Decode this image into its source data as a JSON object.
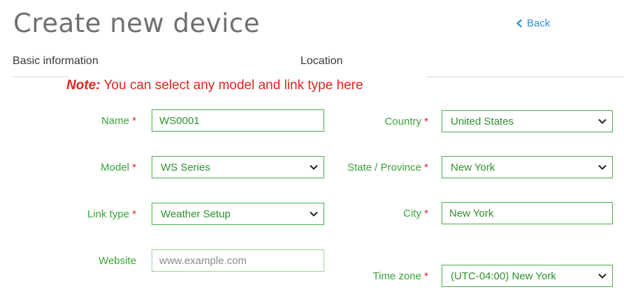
{
  "header": {
    "title": "Create new device",
    "back_label": "Back"
  },
  "sections": {
    "basic": "Basic information",
    "location": "Location"
  },
  "note": {
    "label": "Note:",
    "text": " You can select any model and link type here"
  },
  "required_marker": "*",
  "fields": {
    "name": {
      "label": "Name",
      "value": "WS0001"
    },
    "model": {
      "label": "Model",
      "value": "WS Series"
    },
    "link_type": {
      "label": "Link type",
      "value": "Weather Setup"
    },
    "website": {
      "label": "Website",
      "placeholder": "www.example.com"
    },
    "country": {
      "label": "Country",
      "value": "United States"
    },
    "state": {
      "label": "State / Province",
      "value": "New York"
    },
    "city": {
      "label": "City",
      "value": "New York"
    },
    "timezone": {
      "label": "Time zone",
      "value": "(UTC-04:00) New York"
    }
  },
  "colors": {
    "accent_green": "#3aa33a",
    "required_red": "#e3231f",
    "link_blue": "#2f8fd8",
    "title_gray": "#6f6f6f"
  }
}
